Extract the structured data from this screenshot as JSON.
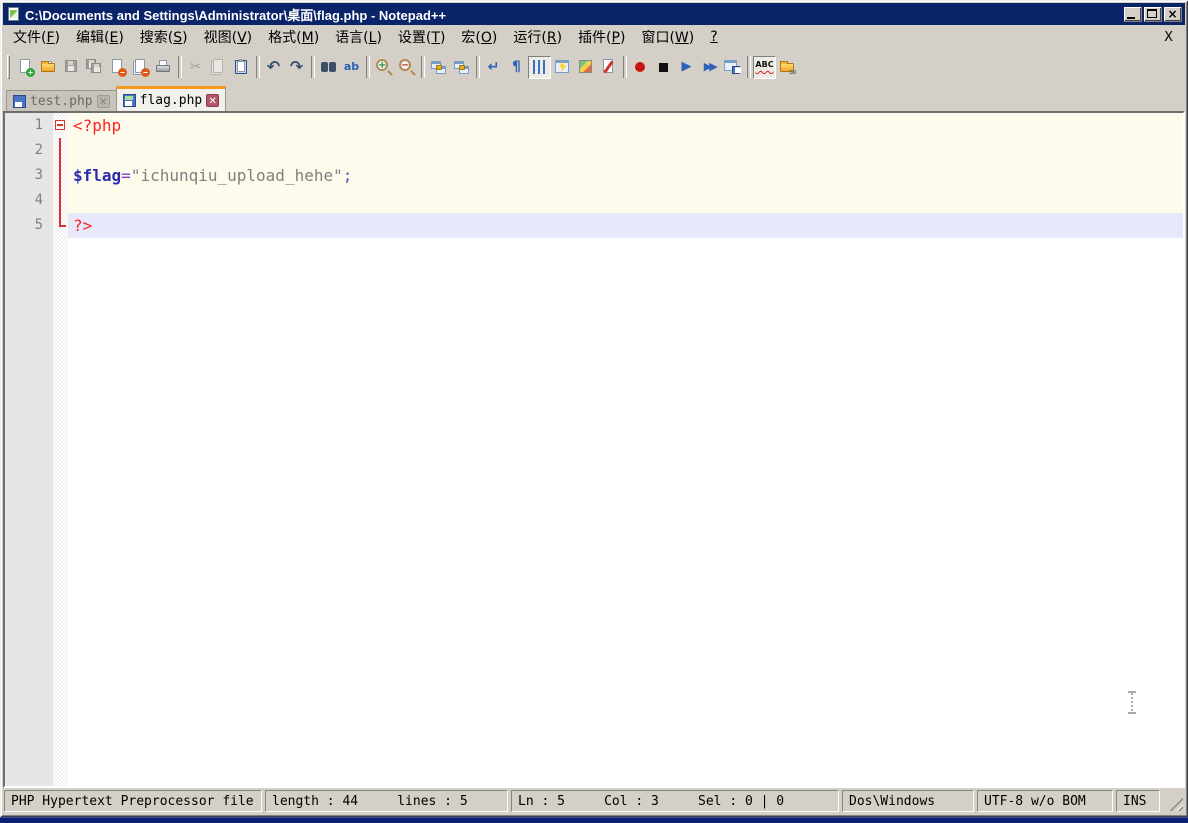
{
  "window": {
    "title": "C:\\Documents and Settings\\Administrator\\桌面\\flag.php - Notepad++",
    "controls": [
      {
        "name": "minimize-button",
        "icon": "minimize-icon"
      },
      {
        "name": "maximize-button",
        "icon": "maximize-icon"
      },
      {
        "name": "close-button",
        "icon": "close-icon",
        "glyph": "×"
      }
    ]
  },
  "menu": {
    "items": [
      {
        "label": "文件",
        "key": "F"
      },
      {
        "label": "编辑",
        "key": "E"
      },
      {
        "label": "搜索",
        "key": "S"
      },
      {
        "label": "视图",
        "key": "V"
      },
      {
        "label": "格式",
        "key": "M"
      },
      {
        "label": "语言",
        "key": "L"
      },
      {
        "label": "设置",
        "key": "T"
      },
      {
        "label": "宏",
        "key": "O"
      },
      {
        "label": "运行",
        "key": "R"
      },
      {
        "label": "插件",
        "key": "P"
      },
      {
        "label": "窗口",
        "key": "W"
      },
      {
        "label": "",
        "key": "?"
      }
    ],
    "close_label": "X"
  },
  "toolbar": {
    "buttons": [
      {
        "name": "new-file",
        "icon": "page-plus-icon",
        "glyph": "page-plus"
      },
      {
        "name": "open-file",
        "icon": "open-folder-icon",
        "glyph": "folder-open"
      },
      {
        "name": "save",
        "icon": "floppy-icon",
        "glyph": "floppy",
        "disabled": true
      },
      {
        "name": "save-all",
        "icon": "floppy-multi-icon",
        "glyph": "floppy-multi",
        "disabled": true
      },
      {
        "name": "close-file",
        "icon": "page-minus-icon",
        "glyph": "page-minus"
      },
      {
        "name": "close-all",
        "icon": "pages-minus-icon",
        "glyph": "pages-minus"
      },
      {
        "name": "print",
        "icon": "printer-icon",
        "glyph": "printer"
      },
      {
        "sep": true
      },
      {
        "name": "cut",
        "icon": "scissors-icon",
        "glyph": "scissors",
        "disabled": true
      },
      {
        "name": "copy",
        "icon": "copy-icon",
        "glyph": "copy",
        "disabled": true
      },
      {
        "name": "paste",
        "icon": "clipboard-icon",
        "glyph": "clipboard"
      },
      {
        "sep": true
      },
      {
        "name": "undo",
        "icon": "undo-arrow-icon",
        "glyph": "undo"
      },
      {
        "name": "redo",
        "icon": "redo-arrow-icon",
        "glyph": "redo"
      },
      {
        "sep": true
      },
      {
        "name": "find",
        "icon": "binoculars-icon",
        "glyph": "binoculars"
      },
      {
        "name": "replace",
        "icon": "replace-icon",
        "glyph": "replace"
      },
      {
        "sep": true
      },
      {
        "name": "zoom-in",
        "icon": "magnifier-plus-icon",
        "glyph": "zoom-in"
      },
      {
        "name": "zoom-out",
        "icon": "magnifier-minus-icon",
        "glyph": "zoom-out"
      },
      {
        "sep": true
      },
      {
        "name": "sync-vertical-scroll",
        "icon": "sync-windows-icon",
        "glyph": "sync"
      },
      {
        "name": "sync-horizontal-scroll",
        "icon": "sync-windows-icon",
        "glyph": "sync"
      },
      {
        "sep": true
      },
      {
        "name": "word-wrap",
        "icon": "wrap-arrow-icon",
        "glyph": "wrap"
      },
      {
        "name": "show-all-characters",
        "icon": "pilcrow-icon",
        "glyph": "pilcrow"
      },
      {
        "name": "show-indent-guide",
        "icon": "indent-guide-icon",
        "glyph": "indent",
        "pressed": true
      },
      {
        "name": "function-completion",
        "icon": "lightning-window-icon",
        "glyph": "lightning"
      },
      {
        "name": "document-map",
        "icon": "map-icon",
        "glyph": "map"
      },
      {
        "name": "document-switcher",
        "icon": "red-pen-page-icon",
        "glyph": "switcher"
      },
      {
        "sep": true
      },
      {
        "name": "macro-record",
        "icon": "record-dot-icon",
        "glyph": "record"
      },
      {
        "name": "macro-stop",
        "icon": "stop-square-icon",
        "glyph": "stop"
      },
      {
        "name": "macro-play",
        "icon": "play-icon",
        "glyph": "play"
      },
      {
        "name": "macro-run-multiple",
        "icon": "double-play-icon",
        "glyph": "play-multi"
      },
      {
        "name": "macro-save",
        "icon": "window-floppy-icon",
        "glyph": "macro-save"
      },
      {
        "sep": true
      },
      {
        "name": "spell-check",
        "icon": "abc-squiggle-icon",
        "glyph": "abc",
        "pressed": true
      },
      {
        "name": "open-containing-folder",
        "icon": "folder-link-icon",
        "glyph": "folder-link"
      }
    ]
  },
  "tabs": [
    {
      "label": "test.php",
      "active": false,
      "saved": true
    },
    {
      "label": "flag.php",
      "active": true,
      "saved": true
    }
  ],
  "editor": {
    "language": "php",
    "palette": {
      "phptag": "#ff2222",
      "variable": "#2b2bb0",
      "operator": "#8040c0",
      "string": "#808080"
    },
    "php_block_bg": "#fdfbec",
    "current_line_bg": "#e8e8fb",
    "current_line": 5,
    "lines": [
      {
        "num": 1,
        "fold": "box-minus",
        "tokens": [
          {
            "t": "<?php",
            "c": "phptag"
          }
        ]
      },
      {
        "num": 2,
        "fold": "line",
        "tokens": []
      },
      {
        "num": 3,
        "fold": "line",
        "tokens": [
          {
            "t": "$flag",
            "c": "variable",
            "bold": true
          },
          {
            "t": "=",
            "c": "operator"
          },
          {
            "t": "\"ichunqiu_upload_hehe\"",
            "c": "string"
          },
          {
            "t": ";",
            "c": "operator"
          }
        ]
      },
      {
        "num": 4,
        "fold": "line",
        "tokens": []
      },
      {
        "num": 5,
        "fold": "corner",
        "tokens": [
          {
            "t": "?>",
            "c": "phptag"
          }
        ]
      }
    ]
  },
  "status_bar": {
    "cells": [
      {
        "name": "doc-type",
        "text": "PHP Hypertext Preprocessor file"
      },
      {
        "name": "doc-size",
        "text": "length : 44     lines : 5"
      },
      {
        "name": "cursor-position",
        "text": "Ln : 5     Col : 3     Sel : 0 | 0"
      },
      {
        "name": "eol-format",
        "text": "Dos\\Windows"
      },
      {
        "name": "encoding",
        "text": "UTF-8 w/o BOM"
      },
      {
        "name": "typing-mode",
        "text": "INS"
      }
    ]
  }
}
